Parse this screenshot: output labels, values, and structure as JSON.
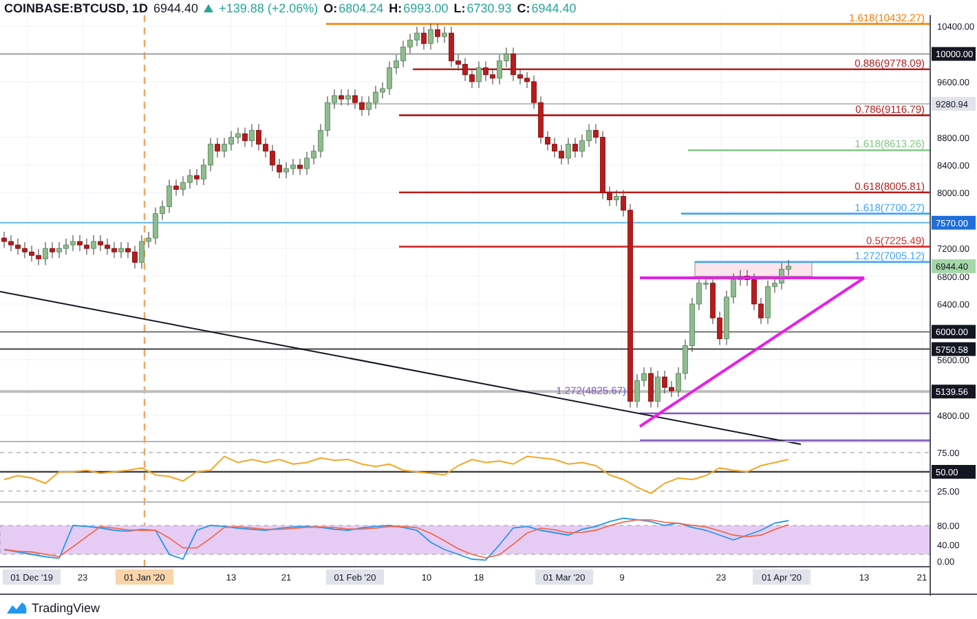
{
  "header": {
    "symbol": "COINBASE:BTCUSD, 1D",
    "last": "6944.40",
    "change": "+139.88 (+2.06%)",
    "ohlc": [
      {
        "label": "O:",
        "value": "6804.24"
      },
      {
        "label": "H:",
        "value": "6993.00"
      },
      {
        "label": "L:",
        "value": "6730.93"
      },
      {
        "label": "C:",
        "value": "6944.40"
      }
    ]
  },
  "fib_levels": [
    {
      "label": "1.618(10432.27)",
      "color": "#f57c00",
      "kind": "right"
    },
    {
      "label": "0.886(9778.09)",
      "color": "#b71c1c",
      "kind": "right"
    },
    {
      "label": "0.786(9116.79)",
      "color": "#b71c1c",
      "kind": "right"
    },
    {
      "label": "1.618(8613.26)",
      "color": "#81c784",
      "kind": "right"
    },
    {
      "label": "0.618(8005.81)",
      "color": "#b71c1c",
      "kind": "right"
    },
    {
      "label": "1.618(7700.27)",
      "color": "#42a5f5",
      "kind": "right"
    },
    {
      "label": "0.5(7225.49)",
      "color": "#d32f2f",
      "kind": "right"
    },
    {
      "label": "1.272(7005.12)",
      "color": "#42a5f5",
      "kind": "right"
    },
    {
      "label": "1.272(4825.67)",
      "color": "#7e57c2",
      "kind": "left"
    }
  ],
  "price_axis": [
    "10400.00",
    "9600.00",
    "8800.00",
    "8400.00",
    "8000.00",
    "7200.00",
    "6800.00",
    "6400.00",
    "5600.00",
    "4800.00"
  ],
  "price_tags": [
    {
      "text": "10000.00",
      "kind": "dark"
    },
    {
      "text": "9280.94",
      "kind": "light"
    },
    {
      "text": "7570.00",
      "kind": "blue"
    },
    {
      "text": "6944.40",
      "kind": "green"
    },
    {
      "text": "6000.00",
      "kind": "dark"
    },
    {
      "text": "5750.58",
      "kind": "dark"
    },
    {
      "text": "5139.56",
      "kind": "dark"
    }
  ],
  "rsi_axis": [
    "75.00",
    "25.00"
  ],
  "rsi_tag": {
    "text": "50.00",
    "kind": "dark"
  },
  "stoch_axis": [
    "80.00",
    "40.00",
    "0.00"
  ],
  "date_axis": [
    {
      "text": "01 Dec '19",
      "kind": "gray"
    },
    {
      "text": "23",
      "kind": "plain"
    },
    {
      "text": "01 Jan '20",
      "kind": "orange"
    },
    {
      "text": "13",
      "kind": "plain"
    },
    {
      "text": "21",
      "kind": "plain"
    },
    {
      "text": "01 Feb '20",
      "kind": "gray"
    },
    {
      "text": "10",
      "kind": "plain"
    },
    {
      "text": "18",
      "kind": "plain"
    },
    {
      "text": "01 Mar '20",
      "kind": "gray"
    },
    {
      "text": "9",
      "kind": "plain"
    },
    {
      "text": "23",
      "kind": "plain"
    },
    {
      "text": "01 Apr '20",
      "kind": "gray"
    },
    {
      "text": "13",
      "kind": "plain"
    },
    {
      "text": "21",
      "kind": "plain"
    }
  ],
  "logo": {
    "text": "TradingView"
  }
}
